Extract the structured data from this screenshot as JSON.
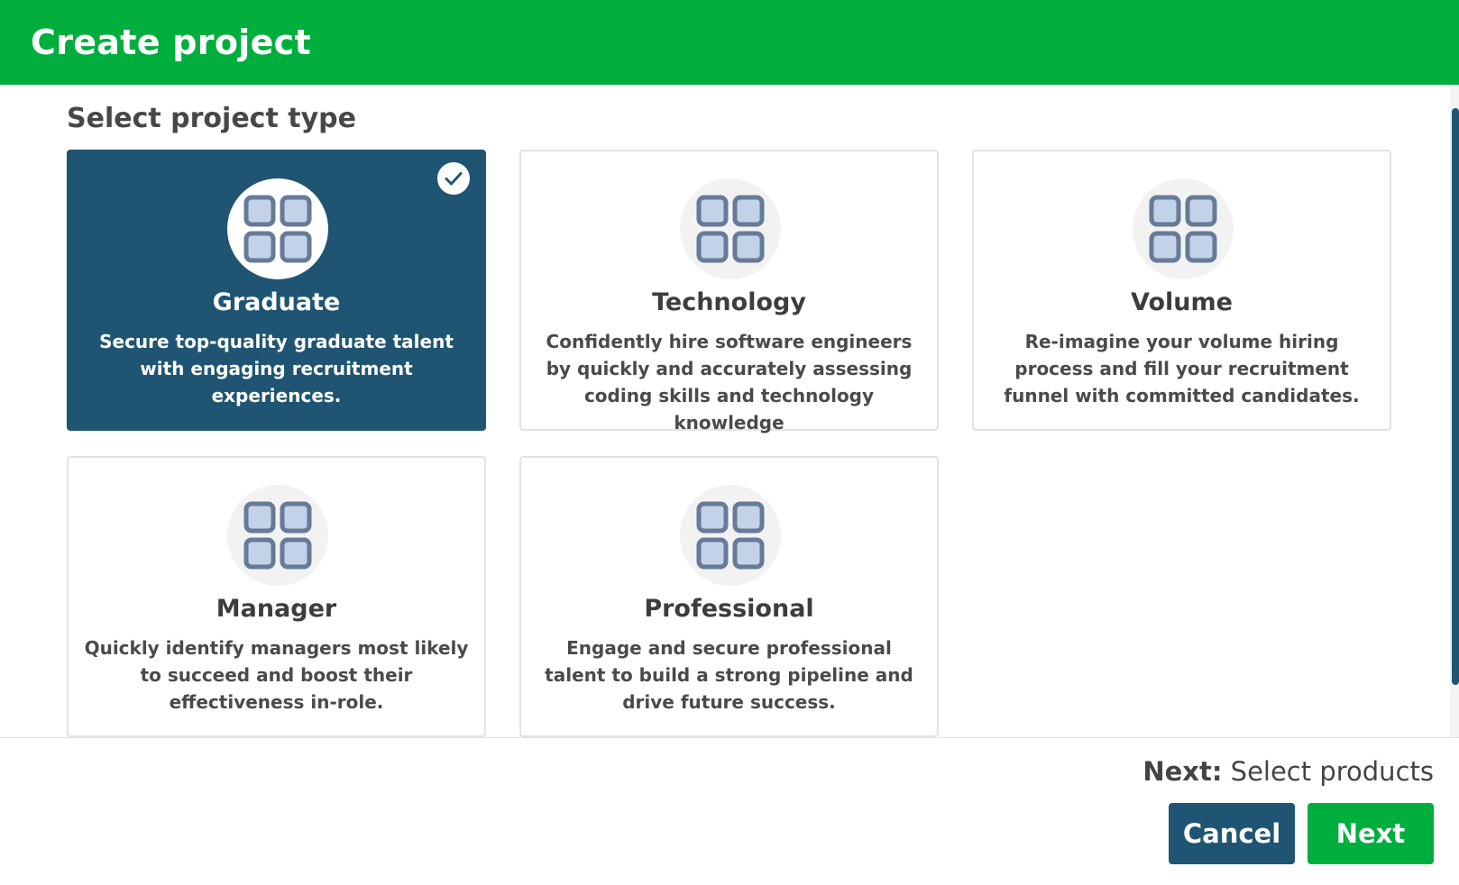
{
  "header": {
    "title": "Create project"
  },
  "section": {
    "title": "Select project type"
  },
  "cards": [
    {
      "title": "Graduate",
      "description": "Secure top-quality graduate talent with engaging recruitment experiences.",
      "selected": true,
      "icon": "grid-icon"
    },
    {
      "title": "Technology",
      "description": "Confidently hire software engineers by quickly and accurately assessing coding skills and technology knowledge",
      "selected": false,
      "icon": "grid-icon"
    },
    {
      "title": "Volume",
      "description": "Re-imagine your volume hiring process and fill your recruitment funnel with committed candidates.",
      "selected": false,
      "icon": "grid-icon"
    },
    {
      "title": "Manager",
      "description": "Quickly identify managers most likely to succeed and boost their effectiveness in-role.",
      "selected": false,
      "icon": "grid-icon"
    },
    {
      "title": "Professional",
      "description": "Engage and secure professional talent to build a strong pipeline and drive future success.",
      "selected": false,
      "icon": "grid-icon"
    }
  ],
  "footer": {
    "next_label": "Next:",
    "next_value": "Select products",
    "cancel_label": "Cancel",
    "next_button_label": "Next"
  },
  "colors": {
    "brand_green": "#00ae3d",
    "selected_blue": "#1f5573",
    "icon_fill": "#c3d2e6",
    "icon_stroke": "#667b98"
  }
}
